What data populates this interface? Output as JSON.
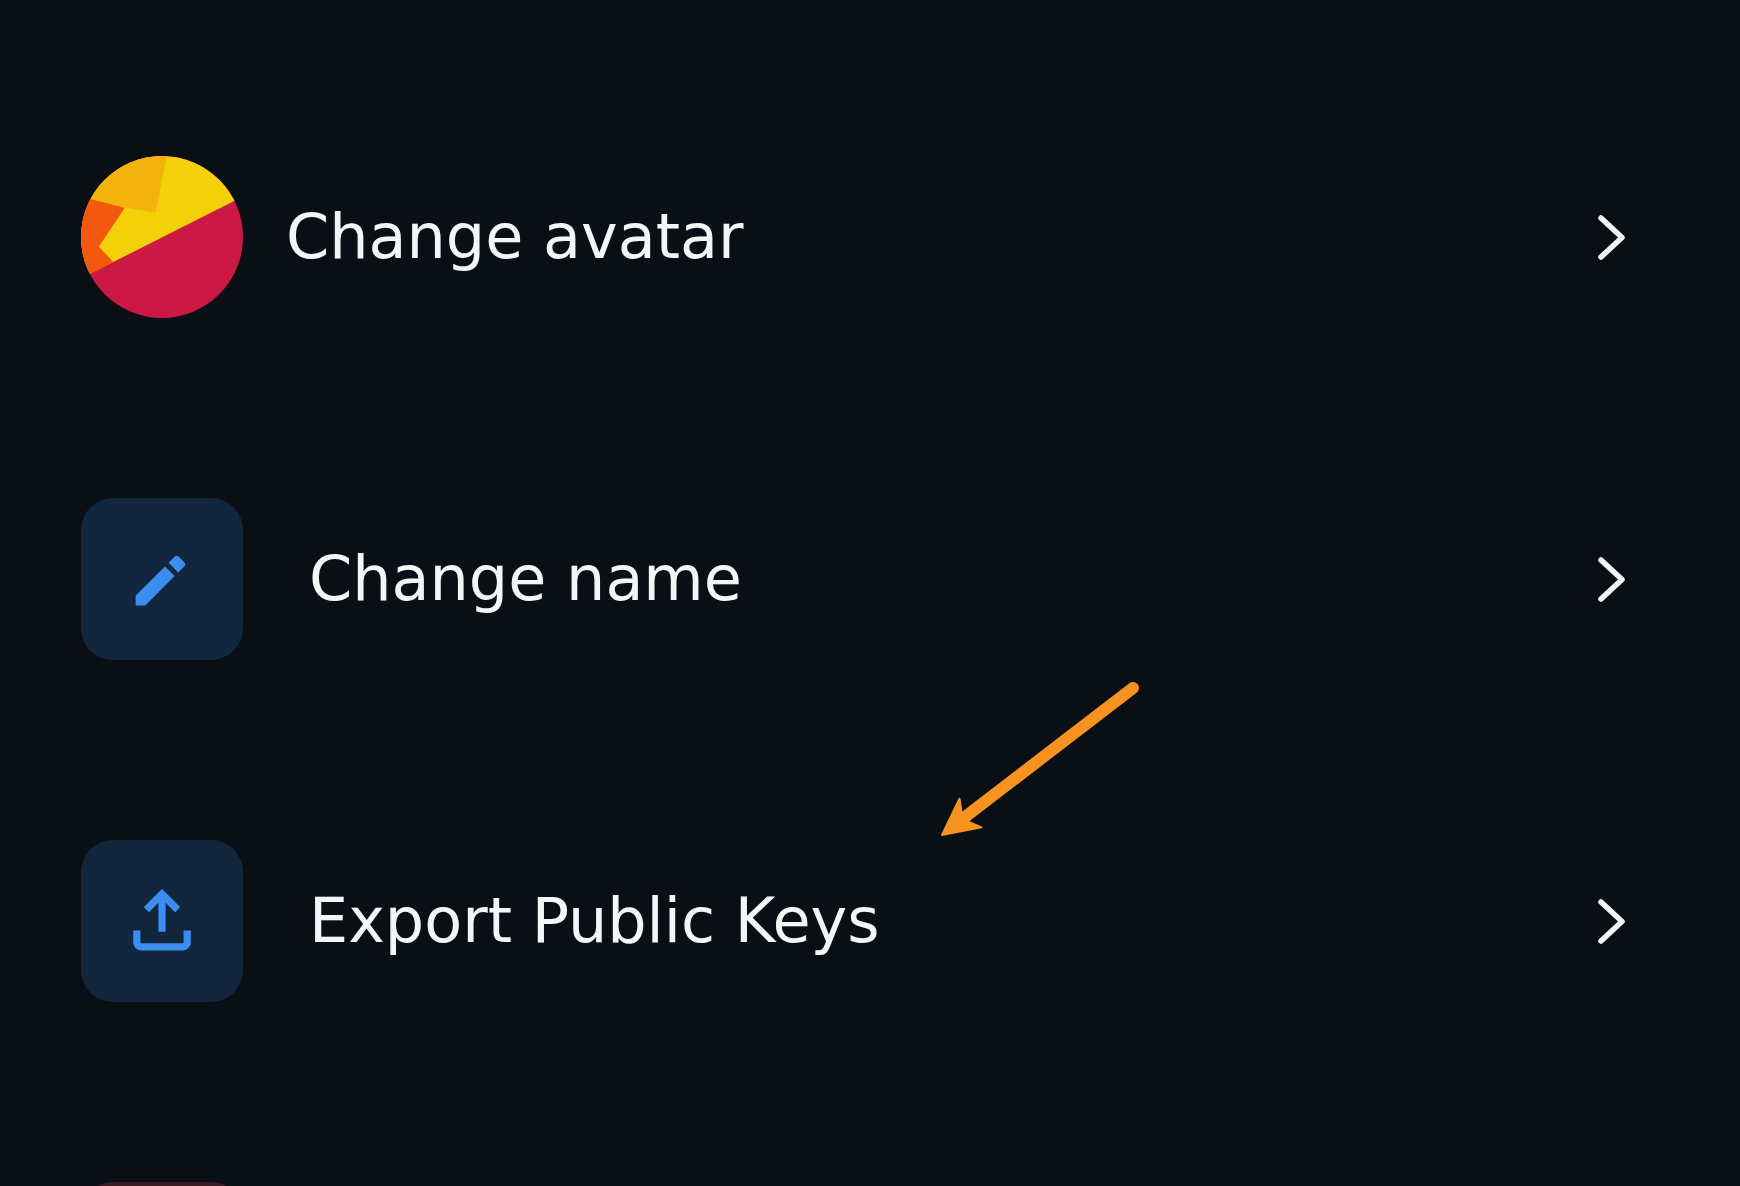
{
  "menu": {
    "items": [
      {
        "kind": "avatar",
        "label": "Change avatar",
        "annotated": false
      },
      {
        "kind": "pencil",
        "label": "Change name",
        "color": "#12273e",
        "annotated": false
      },
      {
        "kind": "upload",
        "label": "Export Public Keys",
        "color": "#12273e",
        "annotated": true
      },
      {
        "kind": "blank",
        "color": "#3b1c24",
        "annotated": false
      }
    ]
  }
}
